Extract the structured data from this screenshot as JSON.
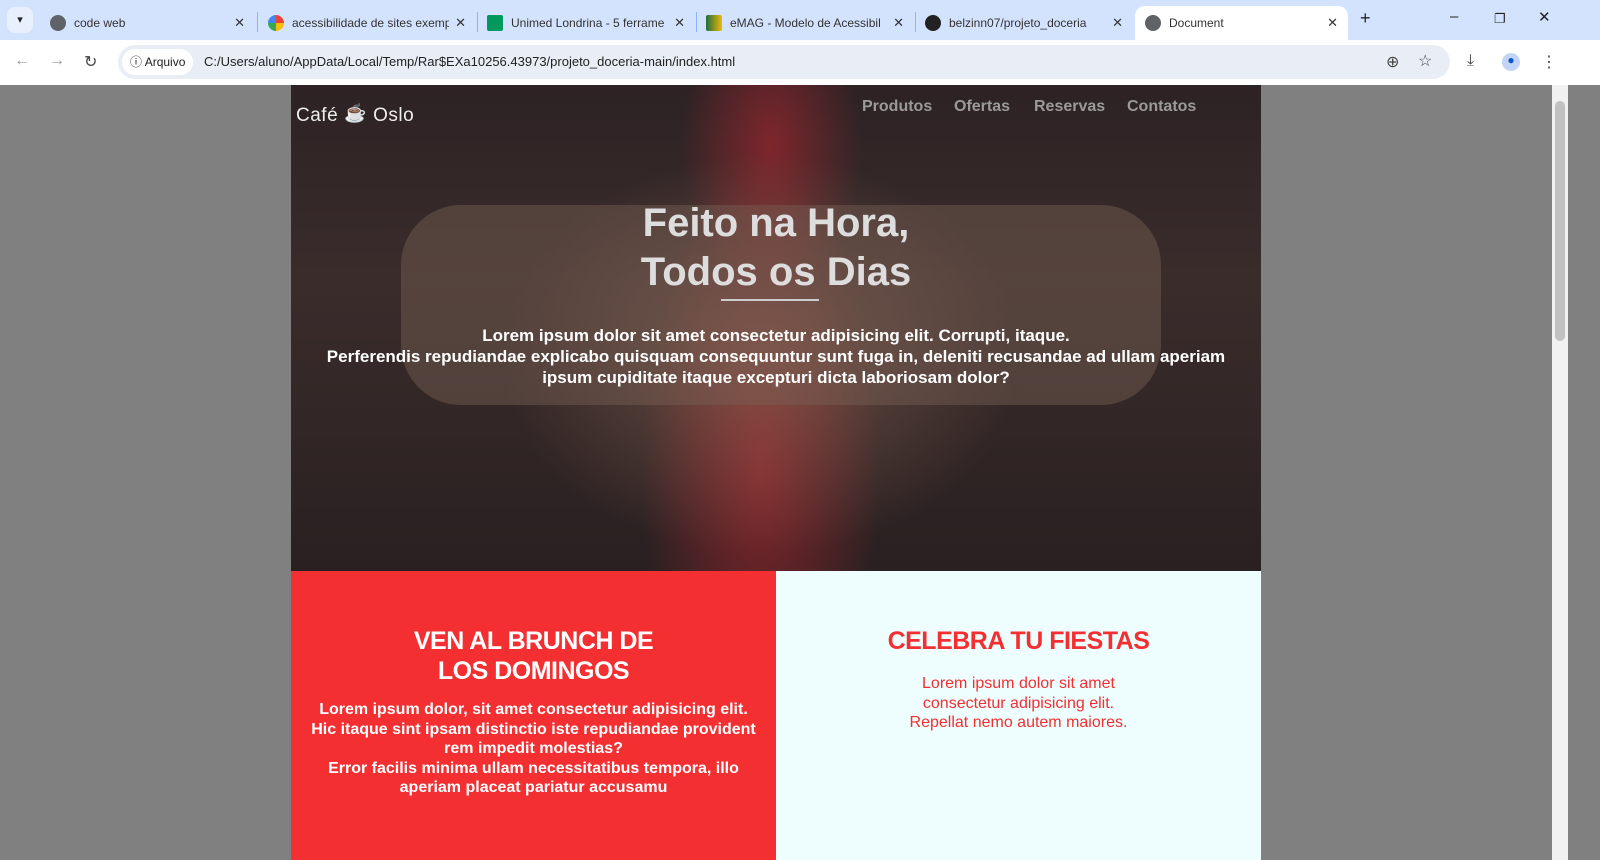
{
  "browser": {
    "tabs": [
      {
        "title": "code web",
        "icon": "globe-icon"
      },
      {
        "title": "acessibilidade de sites exemp",
        "icon": "google-icon"
      },
      {
        "title": "Unimed Londrina - 5 ferrame",
        "icon": "unimed-icon"
      },
      {
        "title": "eMAG - Modelo de Acessibil",
        "icon": "emag-icon"
      },
      {
        "title": "belzinn07/projeto_doceria",
        "icon": "github-icon"
      },
      {
        "title": "Document",
        "icon": "globe-icon",
        "active": true
      }
    ],
    "security_chip": "Arquivo",
    "url": "C:/Users/aluno/AppData/Local/Temp/Rar$EXa10256.43973/projeto_doceria-main/index.html"
  },
  "site": {
    "brand_left": "Café",
    "brand_right": "Oslo",
    "menu": [
      "Produtos",
      "Ofertas",
      "Reservas",
      "Contatos"
    ],
    "hero": {
      "title_line1": "Feito na Hora,",
      "title_line2": "Todos os Dias",
      "text_line1": "Lorem ipsum dolor sit amet consectetur adipisicing elit. Corrupti, itaque.",
      "text_line2": "Perferendis repudiandae explicabo quisquam consequuntur sunt fuga in, deleniti recusandae ad ullam aperiam ipsum cupiditate itaque excepturi dicta laboriosam dolor?"
    },
    "brunch": {
      "title_line1": "VEN AL BRUNCH DE",
      "title_line2": "LOS DOMINGOS",
      "p1": "Lorem ipsum dolor, sit amet consectetur adipisicing elit.",
      "p2": "Hic itaque sint ipsam distinctio iste repudiandae provident rem impedit molestias?",
      "p3": "Error facilis minima ullam necessitatibus tempora, illo aperiam placeat pariatur accusamu"
    },
    "fiestas": {
      "title": "CELEBRA TU FIESTAS",
      "p1": "Lorem ipsum dolor sit amet",
      "p2": "consectetur adipisicing elit.",
      "p3": "Repellat nemo autem maiores."
    }
  },
  "colors": {
    "accent_red": "#f32f32",
    "light_bg": "#eefefe",
    "tabbar": "#d3e3fd"
  }
}
